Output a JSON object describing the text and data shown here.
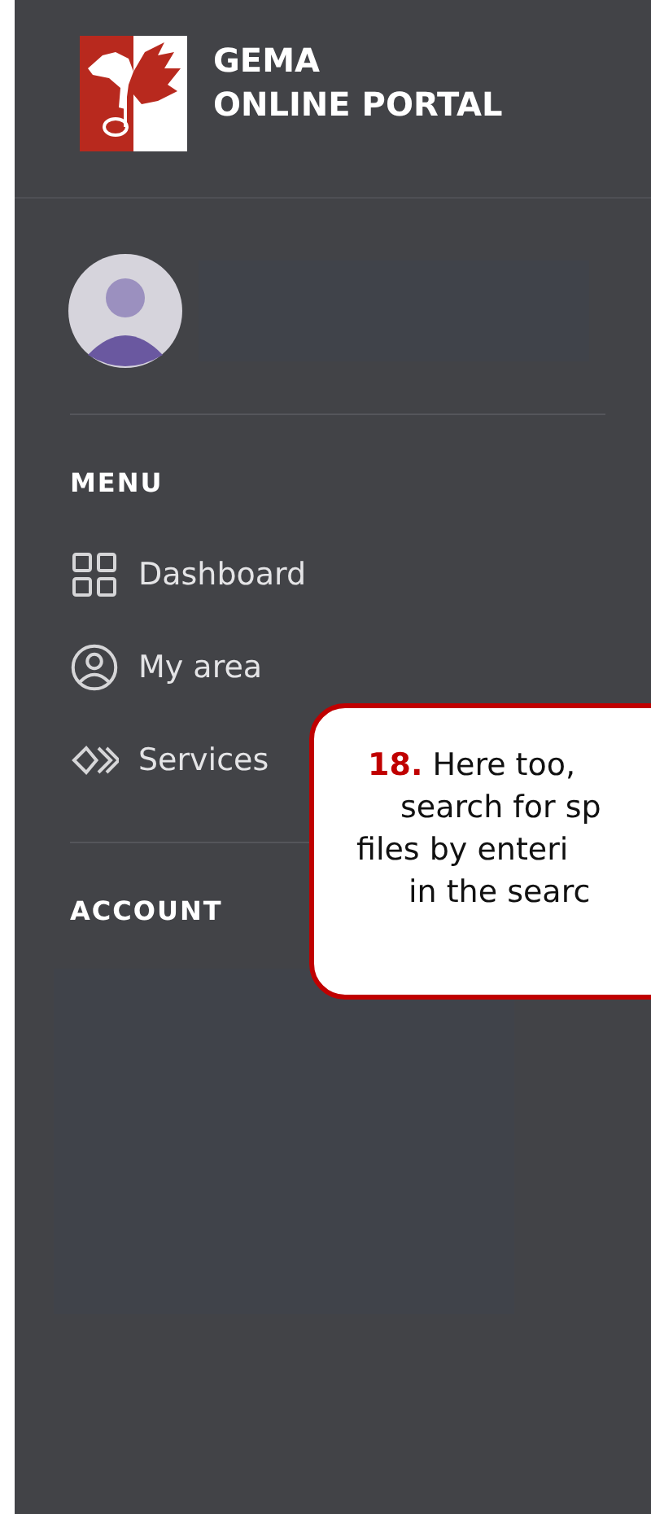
{
  "header": {
    "title_lines": [
      "GEMA",
      "ONLINE PORTAL"
    ]
  },
  "menu": {
    "heading": "MENU",
    "items": [
      {
        "label": "Dashboard",
        "kind": "grid"
      },
      {
        "label": "My area",
        "kind": "person"
      },
      {
        "label": "Services",
        "kind": "chevrons"
      }
    ]
  },
  "account": {
    "heading": "ACCOUNT"
  },
  "callout": {
    "lines": [
      "**18.** Here too,",
      "search for sp",
      "files by enteri",
      "in the searc"
    ]
  }
}
